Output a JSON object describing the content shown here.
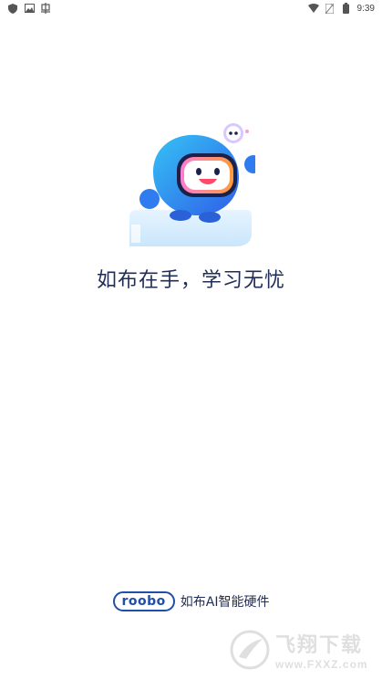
{
  "status_bar": {
    "left_icons": [
      "shield-icon",
      "image-icon",
      "bug-icon"
    ],
    "right_icons": [
      "wifi-icon",
      "no-sim-icon",
      "battery-icon"
    ],
    "time": "9:39"
  },
  "splash": {
    "slogan": "如布在手，学习无忧",
    "brand_logo_text": "roobo",
    "brand_text": "如布AI智能硬件"
  },
  "watermark": {
    "title": "飞翔下载",
    "url": "www.FXXZ.com"
  },
  "colors": {
    "background": "#ffffff",
    "text": "#1f2d57",
    "brand_blue": "#1f4fa8",
    "mascot_blue": "#2f7bf0",
    "mascot_cyan": "#35c2f5"
  }
}
